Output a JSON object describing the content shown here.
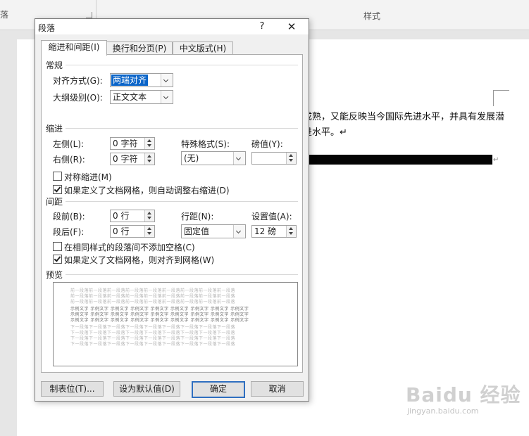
{
  "ribbon": {
    "left_label": "落",
    "right_label": "样式"
  },
  "document": {
    "line1": "成熟，又能反映当今国际先进水平，并具有发展潜",
    "line2": "进水平。↵",
    "para_mark": "↵"
  },
  "watermark": {
    "logo": "Baidu 经验",
    "url": "jingyan.baidu.com"
  },
  "dialog": {
    "title": "段落",
    "help": "?",
    "close": "✕",
    "tabs": [
      "缩进和间距(I)",
      "换行和分页(P)",
      "中文版式(H)"
    ],
    "general": {
      "heading": "常规",
      "alignment_label": "对齐方式(G):",
      "alignment_value": "两端对齐",
      "outline_label": "大纲级别(O):",
      "outline_value": "正文文本"
    },
    "indent": {
      "heading": "缩进",
      "left_label": "左侧(L):",
      "left_value": "0 字符",
      "right_label": "右侧(R):",
      "right_value": "0 字符",
      "special_label": "特殊格式(S):",
      "special_value": "(无)",
      "by_label": "磅值(Y):",
      "by_value": "",
      "mirror_label": "对称缩进(M)",
      "mirror_checked": false,
      "auto_adjust_label": "如果定义了文档网格，则自动调整右缩进(D)",
      "auto_adjust_checked": true
    },
    "spacing": {
      "heading": "间距",
      "before_label": "段前(B):",
      "before_value": "0 行",
      "after_label": "段后(F):",
      "after_value": "0 行",
      "line_label": "行距(N):",
      "line_value": "固定值",
      "at_label": "设置值(A):",
      "at_value": "12 磅",
      "no_space_label": "在相同样式的段落间不添加空格(C)",
      "no_space_checked": false,
      "snap_grid_label": "如果定义了文档网格，则对齐到网格(W)",
      "snap_grid_checked": true
    },
    "preview": {
      "heading": "预览",
      "prev_para": "前一段落前一段落前一段落前一段落前一段落前一段落前一段落前一段落前一段落",
      "sample_text": "示例文字 示例文字 示例文字 示例文字 示例文字 示例文字 示例文字 示例文字 示例文字",
      "next_para": "下一段落下一段落下一段落下一段落下一段落下一段落下一段落下一段落下一段落"
    },
    "buttons": {
      "tabs": "制表位(T)...",
      "set_default": "设为默认值(D)",
      "ok": "确定",
      "cancel": "取消"
    }
  }
}
